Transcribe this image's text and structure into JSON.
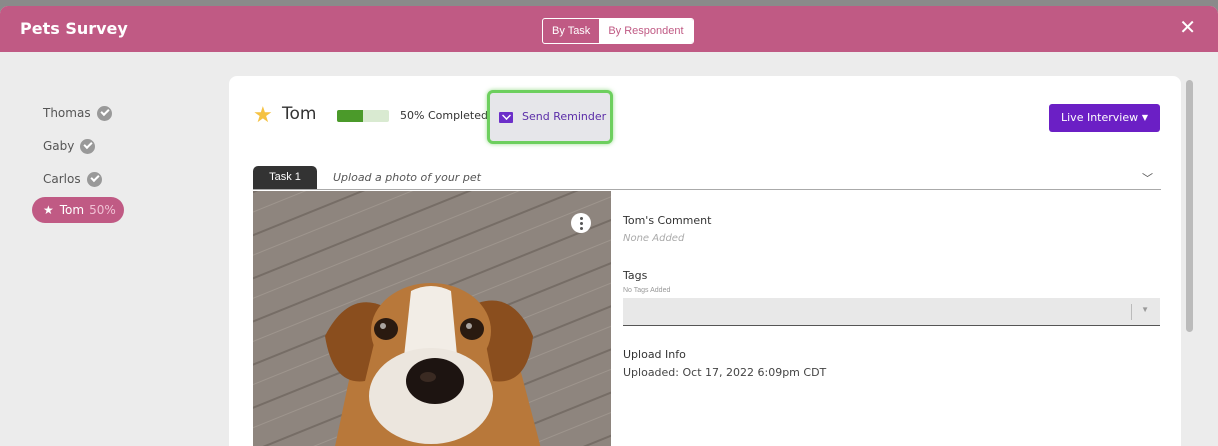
{
  "app": {
    "title": "Pets Survey",
    "close_icon": "close-icon"
  },
  "view_toggle": {
    "by_task": "By Task",
    "by_respondent": "By Respondent",
    "selected": "By Respondent"
  },
  "respondents": [
    {
      "name": "Thomas",
      "status": "complete"
    },
    {
      "name": "Gaby",
      "status": "complete"
    },
    {
      "name": "Carlos",
      "status": "complete"
    },
    {
      "name": "Tom",
      "status": "in-progress",
      "percent": "50%"
    }
  ],
  "header": {
    "name": "Tom",
    "progress_fraction": 0.5,
    "progress_text": "50% Completed",
    "send_reminder": "Send Reminder",
    "live_interview": "Live Interview"
  },
  "task": {
    "tab_label": "Task 1",
    "title": "Upload a photo of your pet"
  },
  "details": {
    "comment_label": "Tom's Comment",
    "comment_value": "None Added",
    "tags_label": "Tags",
    "tags_hint": "No Tags Added",
    "upload_label": "Upload Info",
    "upload_value": "Uploaded: Oct 17, 2022 6:09pm CDT"
  },
  "colors": {
    "brand": "#c05a84",
    "accent": "#6b1fc5",
    "progress": "#4b9a2a",
    "highlight": "#6dcf5e"
  }
}
